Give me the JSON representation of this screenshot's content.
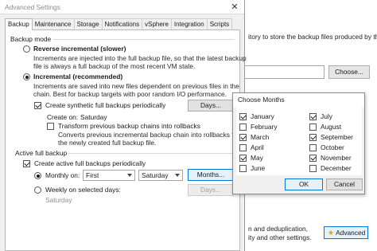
{
  "background_window": {
    "description_text": "itory to store the backup files produced by this",
    "choose_label": "Choose...",
    "text_line1": "n and deduplication,",
    "text_line2": "ity and other settings.",
    "advanced_label": "Advanced"
  },
  "dialog": {
    "title": "Advanced Settings",
    "close": "✕",
    "tabs": [
      "Backup",
      "Maintenance",
      "Storage",
      "Notifications",
      "vSphere",
      "Integration",
      "Scripts"
    ],
    "backup_mode": {
      "label": "Backup mode",
      "reverse_label": "Reverse incremental (slower)",
      "reverse_desc1": "Increments are injected into the full backup file, so that the latest backup",
      "reverse_desc2": "file is always a full backup of the most recent VM state.",
      "incremental_label": "Incremental (recommended)",
      "incremental_desc1": "Increments are saved into new files dependent on previous files in the",
      "incremental_desc2": "chain. Best for backup targets with poor random I/O performance.",
      "synthetic_label": "Create synthetic full backups periodically",
      "days_label": "Days...",
      "create_on_label": "Create on:",
      "create_on_value": "Saturday",
      "transform_label": "Transform previous backup chains into rollbacks",
      "transform_desc1": "Converts previous incremental backup chain into rollbacks for",
      "transform_desc2": "the newly created full backup file."
    },
    "active_full": {
      "label": "Active full backup",
      "create_active_label": "Create active full backups periodically",
      "monthly_label": "Monthly on:",
      "monthly_first": "First",
      "monthly_day": "Saturday",
      "months_button": "Months...",
      "weekly_label": "Weekly on selected days:",
      "weekly_days_button": "Days...",
      "weekly_value": "Saturday"
    }
  },
  "choose_months": {
    "title": "Choose Months",
    "months": [
      {
        "name": "January",
        "checked": true
      },
      {
        "name": "February",
        "checked": false
      },
      {
        "name": "March",
        "checked": true
      },
      {
        "name": "April",
        "checked": false
      },
      {
        "name": "May",
        "checked": true
      },
      {
        "name": "June",
        "checked": false
      },
      {
        "name": "July",
        "checked": true
      },
      {
        "name": "August",
        "checked": false
      },
      {
        "name": "September",
        "checked": true
      },
      {
        "name": "October",
        "checked": false
      },
      {
        "name": "November",
        "checked": true
      },
      {
        "name": "December",
        "checked": false
      }
    ],
    "ok_label": "OK",
    "cancel_label": "Cancel"
  }
}
